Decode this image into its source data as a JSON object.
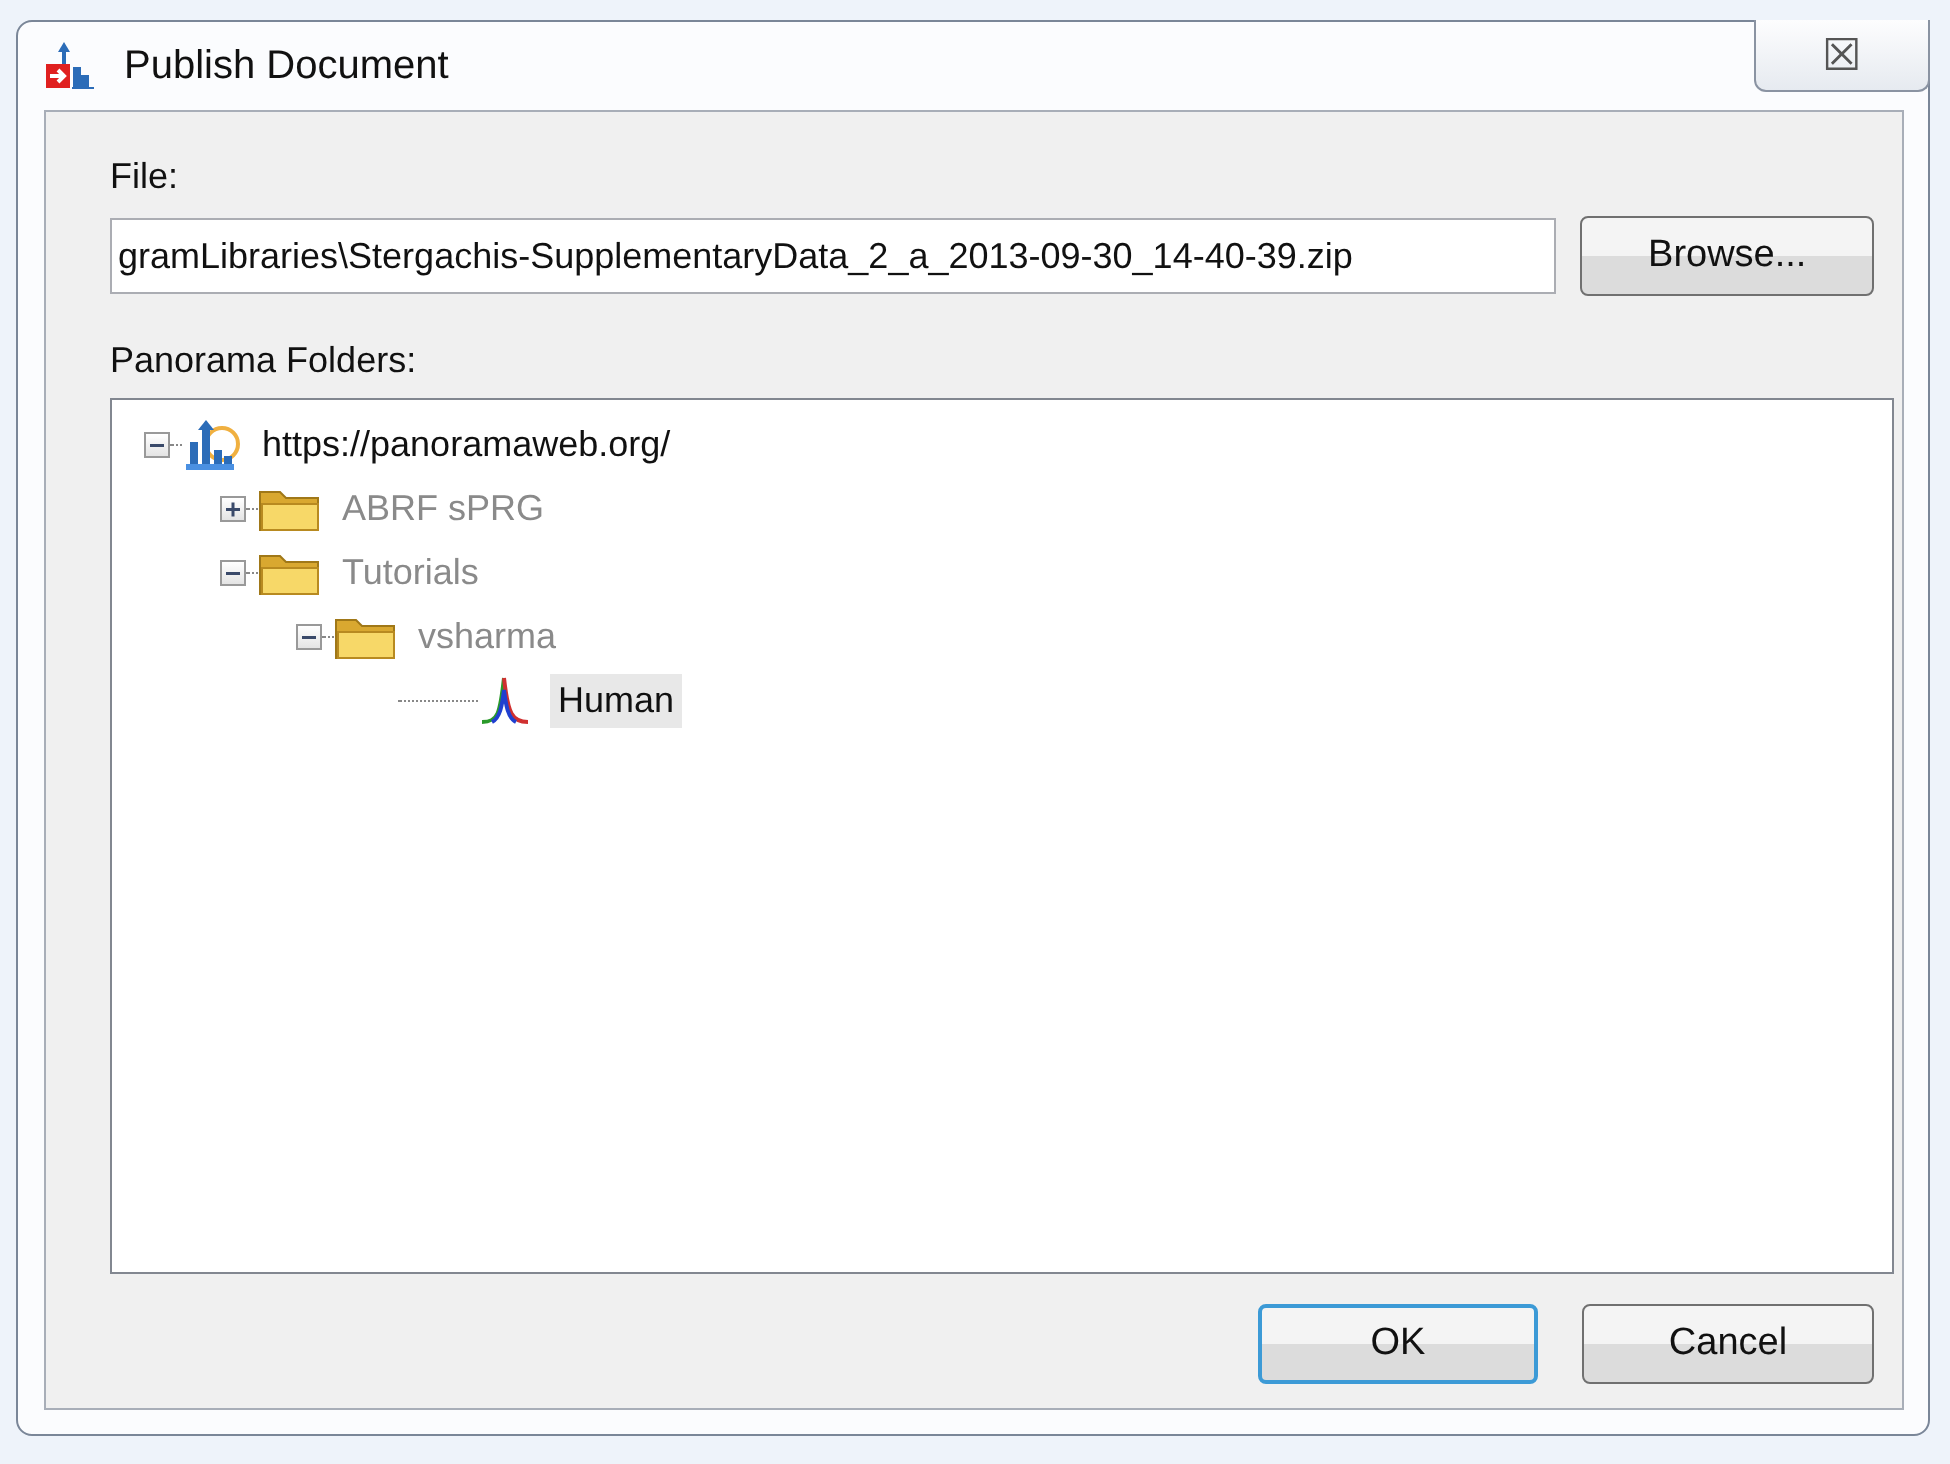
{
  "window": {
    "title": "Publish Document",
    "close_label": "☒"
  },
  "file": {
    "label": "File:",
    "value": "gramLibraries\\Stergachis-SupplementaryData_2_a_2013-09-30_14-40-39.zip",
    "browse": "Browse..."
  },
  "folders": {
    "label": "Panorama Folders:",
    "tree": [
      {
        "kind": "server",
        "label": "https://panoramaweb.org/",
        "expanded": true,
        "disabled": false,
        "selected": false,
        "children": [
          {
            "kind": "folder",
            "label": "ABRF sPRG",
            "expanded": false,
            "disabled": true,
            "selected": false
          },
          {
            "kind": "folder",
            "label": "Tutorials",
            "expanded": true,
            "disabled": true,
            "selected": false,
            "children": [
              {
                "kind": "folder",
                "label": "vsharma",
                "expanded": true,
                "disabled": true,
                "selected": false,
                "children": [
                  {
                    "kind": "document",
                    "label": "Human",
                    "disabled": false,
                    "selected": true
                  }
                ]
              }
            ]
          }
        ]
      }
    ]
  },
  "buttons": [
    {
      "label": "OK",
      "default": true
    },
    {
      "label": "Cancel",
      "default": false
    }
  ]
}
